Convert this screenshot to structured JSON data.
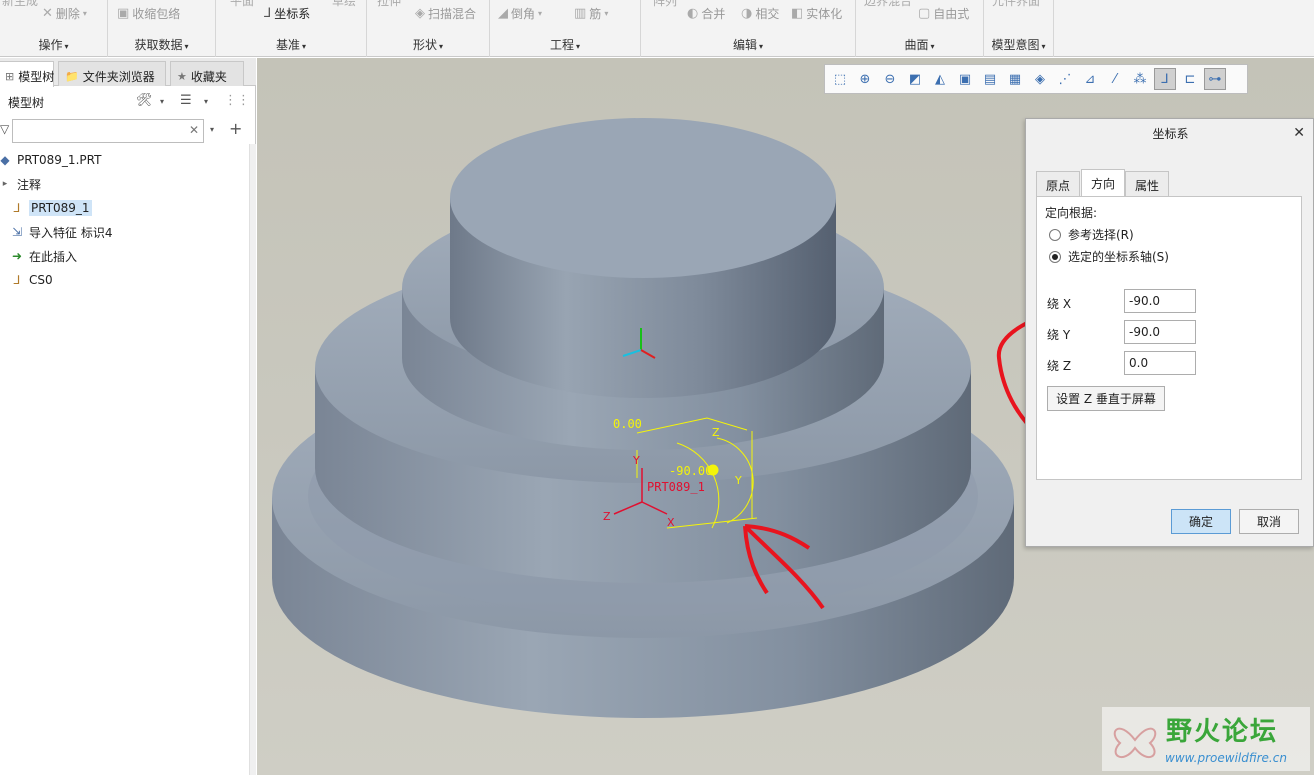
{
  "ribbon": {
    "groups": [
      {
        "label": "操作"
      },
      {
        "label": "获取数据"
      },
      {
        "label": "基准"
      },
      {
        "label": "形状"
      },
      {
        "label": "工程"
      },
      {
        "label": "编辑"
      },
      {
        "label": "曲面"
      },
      {
        "label": "模型意图"
      }
    ],
    "buttons": {
      "regen": "新生成",
      "delete": "删除",
      "shrinkwrap": "收缩包络",
      "plane": "平面",
      "csys": "坐标系",
      "sketch": "草绘",
      "extrude": "拉伸",
      "sweep_blend": "扫描混合",
      "round": "倒角",
      "rib": "筋",
      "pattern": "阵列",
      "merge": "合并",
      "intersect": "相交",
      "solidify": "实体化",
      "boundary": "边界混合",
      "freestyle": "自由式",
      "component_iface": "元件界面"
    }
  },
  "left_panel": {
    "tabs": [
      "模型树",
      "文件夹浏览器",
      "收藏夹"
    ],
    "tree_title": "模型树",
    "filter_placeholder": "",
    "nodes": [
      {
        "label": "PRT089_1.PRT",
        "icon": "part-icon"
      },
      {
        "label": "注释",
        "icon": "expand-icon"
      },
      {
        "label": "PRT089_1",
        "icon": "csys-icon"
      },
      {
        "label": "导入特征 标识4",
        "icon": "import-feature-icon"
      },
      {
        "label": "在此插入",
        "icon": "insert-here-icon"
      },
      {
        "label": "CS0",
        "icon": "csys-icon"
      }
    ]
  },
  "viewport": {
    "annotations": {
      "angle_top": "0.00",
      "angle_mid": "-90.00",
      "csys_label": "PRT089_1",
      "axis_y": "Y",
      "axis_z": "Z",
      "axis_x": "X"
    }
  },
  "dialog": {
    "title": "坐标系",
    "tabs": [
      "原点",
      "方向",
      "属性"
    ],
    "active_tab": "方向",
    "orient_label": "定向根据:",
    "radio_ref": "参考选择(R)",
    "radio_axes": "选定的坐标系轴(S)",
    "axes": [
      {
        "label": "绕 X",
        "value": "-90.0"
      },
      {
        "label": "绕 Y",
        "value": "-90.0"
      },
      {
        "label": "绕 Z",
        "value": "0.0"
      }
    ],
    "setz_button": "设置 Z 垂直于屏幕",
    "ok": "确定",
    "cancel": "取消"
  },
  "watermark": {
    "title": "野火论坛",
    "url": "www.proewildfire.cn"
  },
  "colors": {
    "highlight_red": "#e8141e",
    "annotation_yellow": "#f4f40a",
    "model_blue_gray": "#8e9aa8",
    "viewport_bg": "#c8c7bd",
    "ok_button": "#cce4f7"
  }
}
